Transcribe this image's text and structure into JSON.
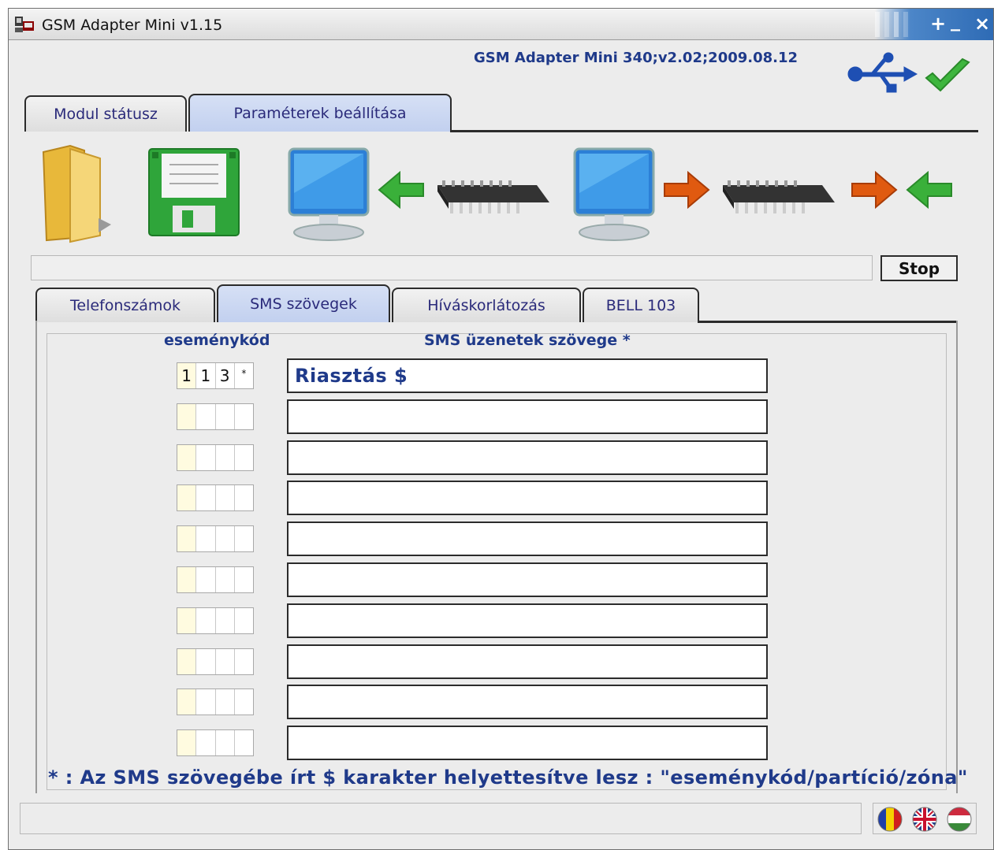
{
  "window": {
    "title": "GSM Adapter Mini v1.15",
    "controls": {
      "maximize": "+",
      "minimize": "_",
      "close": "×"
    }
  },
  "device_info": "GSM Adapter Mini 340;v2.02;2009.08.12",
  "main_tabs": [
    {
      "label": "Modul státusz",
      "active": false
    },
    {
      "label": "Paraméterek beállítása",
      "active": true
    }
  ],
  "toolbar": {
    "icons": [
      "folder-icon",
      "save-icon",
      "read-from-module-icon",
      "write-to-module-icon",
      "transfer-arrows-icon"
    ]
  },
  "stop_button": "Stop",
  "sub_tabs": [
    {
      "label": "Telefonszámok",
      "active": false
    },
    {
      "label": "SMS szövegek",
      "active": true
    },
    {
      "label": "Híváskorlátozás",
      "active": false
    },
    {
      "label": "BELL 103",
      "active": false
    }
  ],
  "columns": {
    "code": "eseménykód",
    "text": "SMS üzenetek szövege *"
  },
  "rows": [
    {
      "code": [
        "1",
        "1",
        "3",
        "*"
      ],
      "text": "Riasztás $"
    },
    {
      "code": [
        "",
        "",
        "",
        ""
      ],
      "text": ""
    },
    {
      "code": [
        "",
        "",
        "",
        ""
      ],
      "text": ""
    },
    {
      "code": [
        "",
        "",
        "",
        ""
      ],
      "text": ""
    },
    {
      "code": [
        "",
        "",
        "",
        ""
      ],
      "text": ""
    },
    {
      "code": [
        "",
        "",
        "",
        ""
      ],
      "text": ""
    },
    {
      "code": [
        "",
        "",
        "",
        ""
      ],
      "text": ""
    },
    {
      "code": [
        "",
        "",
        "",
        ""
      ],
      "text": ""
    },
    {
      "code": [
        "",
        "",
        "",
        ""
      ],
      "text": ""
    },
    {
      "code": [
        "",
        "",
        "",
        ""
      ],
      "text": ""
    }
  ],
  "footnote": "* : Az SMS szövegébe írt $ karakter helyettesítve lesz : \"eseménykód/partíció/zóna\"",
  "languages": [
    "romanian-flag-icon",
    "english-flag-icon",
    "hungarian-flag-icon"
  ],
  "colors": {
    "accent_text": "#1f3a8a",
    "active_tab": "#c8d4f0",
    "green_arrow": "#3ab03a",
    "orange_arrow": "#e05a10"
  }
}
